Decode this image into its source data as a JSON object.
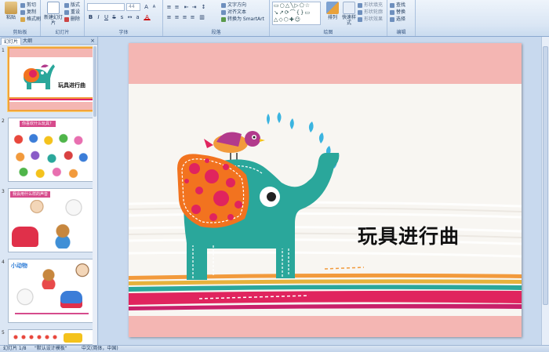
{
  "ribbon": {
    "clipboard": {
      "label": "剪贴板",
      "paste": "粘贴",
      "cut": "剪切",
      "copy": "复制",
      "format_painter": "格式刷"
    },
    "slides": {
      "label": "幻灯片",
      "new_slide": "新建幻灯片",
      "layout": "版式",
      "reset": "重设",
      "delete": "删除"
    },
    "font": {
      "label": "字体",
      "font_name": "",
      "font_size": "44"
    },
    "paragraph": {
      "label": "段落",
      "text_direction": "文字方向",
      "align_text": "对齐文本",
      "smartart": "转换为 SmartArt"
    },
    "drawing": {
      "label": "绘图",
      "arrange": "排列",
      "quick_styles": "快速样式",
      "shape_fill": "形状填充",
      "shape_outline": "形状轮廓",
      "shape_effects": "形状效果"
    },
    "editing": {
      "label": "编辑",
      "find": "查找",
      "replace": "替换",
      "select": "选择"
    }
  },
  "left_pane": {
    "tabs": [
      "幻灯片",
      "大纲"
    ],
    "close": "×",
    "thumbs": [
      {
        "num": "1",
        "title": "玩具进行曲"
      },
      {
        "num": "2",
        "title": "你喜欢什么玩具？"
      },
      {
        "num": "3",
        "title": "我会用什么样的声音"
      },
      {
        "num": "4",
        "title": "小动物"
      },
      {
        "num": "5"
      }
    ]
  },
  "slide": {
    "title": "玩具进行曲"
  },
  "status": {
    "slide_info": "幻灯片 1/8",
    "theme": "\"默认设计模板\"",
    "language": "中文(简体，中国)"
  },
  "colors": {
    "accent_orange": "#f2a33a",
    "elephant": "#2aa79b",
    "pink_band": "#f4b6b3"
  }
}
